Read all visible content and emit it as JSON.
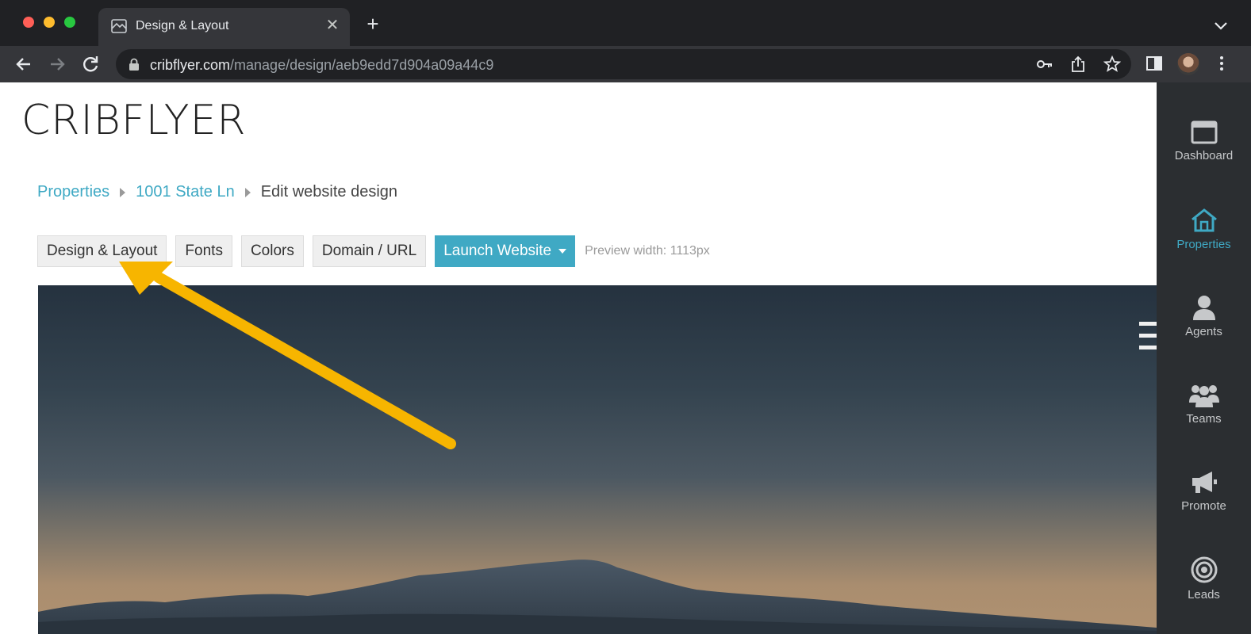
{
  "browser": {
    "tab_title": "Design & Layout",
    "url_host": "cribflyer.com",
    "url_path": "/manage/design/aeb9edd7d904a09a44c9",
    "icons": [
      "back-arrow-icon",
      "forward-arrow-icon",
      "reload-icon",
      "lock-icon",
      "key-icon",
      "share-icon",
      "star-icon",
      "side-panel-icon",
      "menu-dots-icon"
    ]
  },
  "page": {
    "logo": "CRIBFLYER",
    "breadcrumb": {
      "items": [
        "Properties",
        "1001 State Ln"
      ],
      "current": "Edit website design"
    },
    "design_tabs": [
      "Design & Layout",
      "Fonts",
      "Colors",
      "Domain / URL"
    ],
    "launch_button": "Launch Website",
    "preview_width": "Preview width: 1113px"
  },
  "sidebar": {
    "items": [
      {
        "label": "Dashboard",
        "icon": "window-icon"
      },
      {
        "label": "Properties",
        "icon": "home-icon",
        "active": true
      },
      {
        "label": "Agents",
        "icon": "person-icon"
      },
      {
        "label": "Teams",
        "icon": "group-icon"
      },
      {
        "label": "Promote",
        "icon": "megaphone-icon"
      },
      {
        "label": "Leads",
        "icon": "target-icon"
      }
    ]
  },
  "colors": {
    "accent": "#3fa9c4",
    "sidebar_bg": "#2b2e31",
    "annotation_arrow": "#f7b500"
  }
}
